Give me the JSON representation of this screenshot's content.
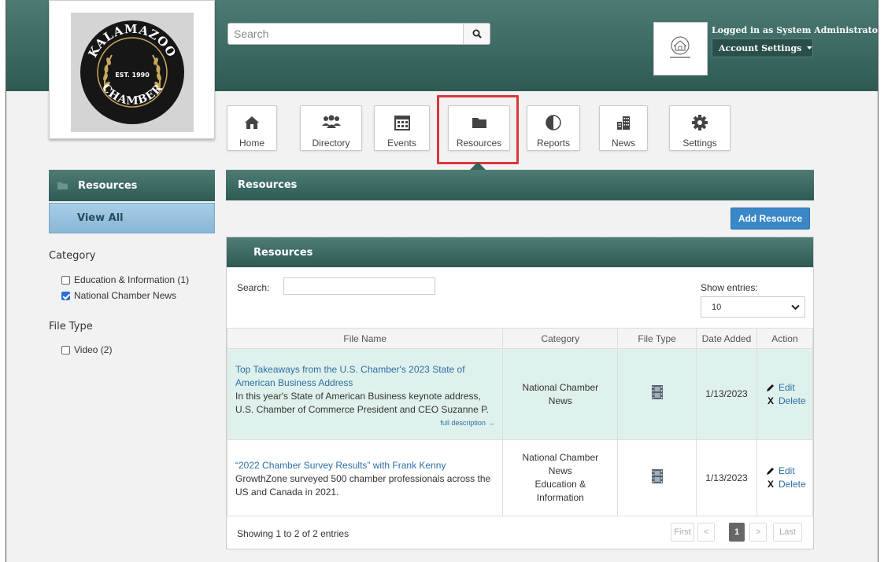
{
  "header": {
    "search_placeholder": "Search",
    "user_status": "Logged in as System Administrator",
    "account_settings_label": "Account Settings",
    "org_logo_text": "KALAMAZOO",
    "org_logo_year": "EST. 1990",
    "org_logo_bottom": "CHAMBER"
  },
  "nav": {
    "items": [
      {
        "label": "Home",
        "icon": "home-icon"
      },
      {
        "label": "Directory",
        "icon": "people-icon"
      },
      {
        "label": "Events",
        "icon": "calendar-icon"
      },
      {
        "label": "Resources",
        "icon": "folder-icon",
        "highlighted": true
      },
      {
        "label": "Reports",
        "icon": "pie-chart-icon"
      },
      {
        "label": "News",
        "icon": "buildings-icon"
      },
      {
        "label": "Settings",
        "icon": "gear-icon"
      }
    ],
    "highlight_color": "#d9383a"
  },
  "sidebar": {
    "resources_label": "Resources",
    "view_all_label": "View All",
    "category_heading": "Category",
    "categories": [
      {
        "label": "Education & Information (1)",
        "checked": false
      },
      {
        "label": "National Chamber News",
        "checked": true
      }
    ],
    "file_type_heading": "File Type",
    "file_types": [
      {
        "label": "Video (2)",
        "checked": false
      }
    ]
  },
  "main": {
    "title": "Resources",
    "add_button_label": "Add Resource",
    "panel_title": "Resources",
    "search_label": "Search:",
    "show_entries_label": "Show entries:",
    "show_entries_value": "10",
    "columns": [
      "File Name",
      "Category",
      "File Type",
      "Date Added",
      "Action"
    ],
    "rows": [
      {
        "title_line1": "Top Takeaways from the U.S. Chamber's 2023 State of",
        "title_line2": "American Business Address",
        "desc_line1": "In this year's State of American Business keynote address,",
        "desc_line2": "U.S. Chamber of Commerce President and CEO Suzanne P.",
        "full_description": "full description →",
        "category_lines": [
          "National Chamber",
          "News"
        ],
        "date": "1/13/2023",
        "edit": "Edit",
        "delete": "Delete"
      },
      {
        "title_line1": "“2022 Chamber Survey Results” with Frank Kenny",
        "desc_line1": "GrowthZone surveyed 500 chamber professionals across the",
        "desc_line2": "US and Canada in 2021.",
        "category_lines": [
          "National Chamber",
          "News",
          "Education &",
          "Information"
        ],
        "date": "1/13/2023",
        "edit": "Edit",
        "delete": "Delete"
      }
    ],
    "showing_text": "Showing 1 to 2 of 2 entries",
    "pagination": [
      "First",
      "<",
      "1",
      ">",
      "Last"
    ]
  },
  "colors": {
    "header_teal": "#3a6862",
    "row_highlight": "#dff1ec",
    "link_blue": "#2c6fa5",
    "button_blue": "#3a88c8"
  }
}
